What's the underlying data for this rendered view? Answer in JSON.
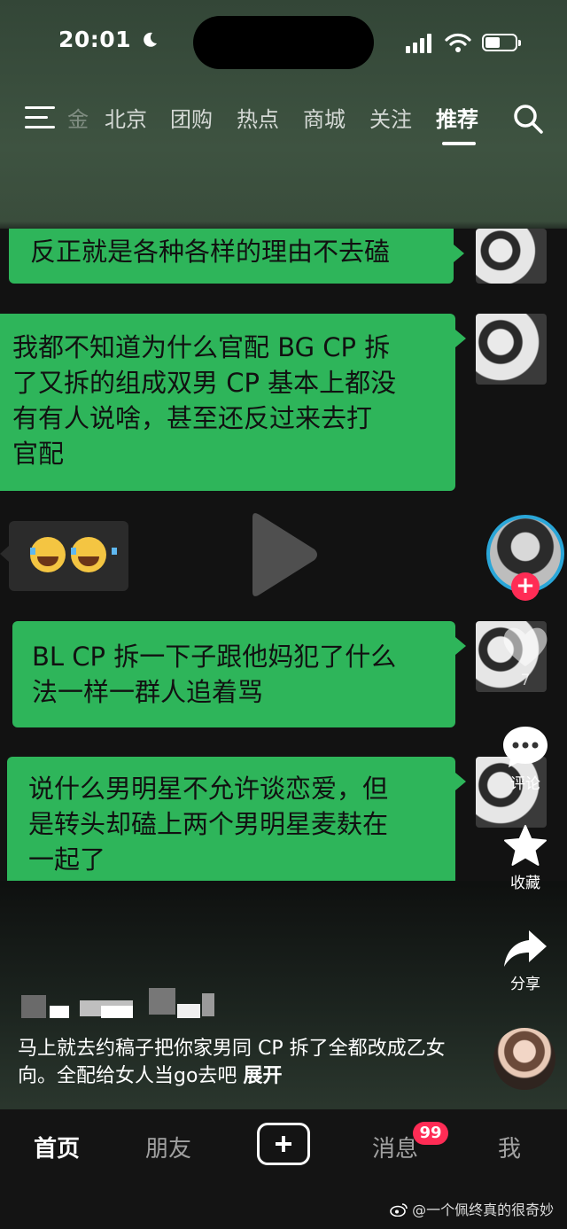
{
  "status_bar": {
    "time": "20:01",
    "battery_level": 0.5
  },
  "top_nav": {
    "clipped_tab": "金",
    "tabs": [
      "北京",
      "团购",
      "热点",
      "商城",
      "关注",
      "推荐"
    ],
    "active_tab": "推荐"
  },
  "video": {
    "messages": [
      {
        "text_lines": [
          "反正就是各种各样的理由不去磕"
        ]
      },
      {
        "text_lines": [
          "我都不知道为什么官配 BG CP 拆",
          "了又拆的组成双男 CP 基本上都没",
          "有有人说啥，甚至还反过来去打",
          "官配"
        ]
      },
      {
        "text_lines": [
          "BL CP 拆一下子跟他妈犯了什么",
          "法一样一群人追着骂"
        ]
      },
      {
        "text_lines": [
          "说什么男明星不允许谈恋爱，但",
          "是转头却磕上两个男明星麦麸在",
          "一起了"
        ]
      }
    ],
    "reaction_emojis": [
      "joy-emoji",
      "joy-emoji"
    ]
  },
  "rail": {
    "like_count": "7",
    "comment_label": "评论",
    "collect_label": "收藏",
    "share_label": "分享"
  },
  "caption": {
    "text": "马上就去约稿子把你家男同 CP 拆了全都改成乙女向。全配给女人当go去吧",
    "expand_label": "展开"
  },
  "bottom_nav": {
    "tabs": [
      "首页",
      "朋友",
      "消息",
      "我"
    ],
    "active_tab": "首页",
    "messages_badge": "99"
  },
  "watermark": "@一个佩终真的很奇妙",
  "colors": {
    "chat_bubble": "#2eb55a",
    "accent": "#ff2c55",
    "avatar_ring": "#2aa6d8"
  }
}
